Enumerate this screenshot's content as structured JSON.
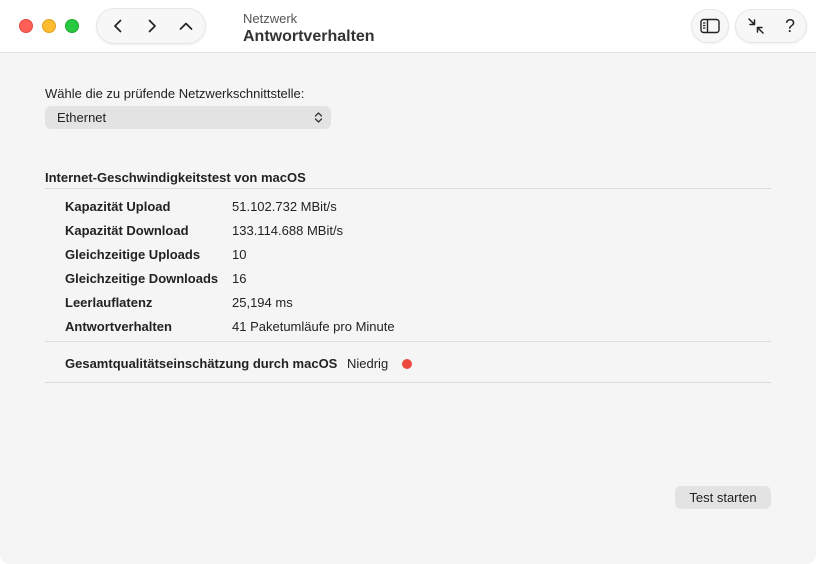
{
  "titlebar": {
    "subtitle": "Netzwerk",
    "title": "Antwortverhalten",
    "help_label": "?"
  },
  "interface": {
    "prompt": "Wähle die zu prüfende Netzwerkschnittstelle:",
    "selected": "Ethernet"
  },
  "speedtest": {
    "section_title": "Internet-Geschwindigkeitstest von macOS",
    "rows": [
      {
        "label": "Kapazität Upload",
        "value": "51.102.732 MBit/s"
      },
      {
        "label": "Kapazität Download",
        "value": "133.114.688 MBit/s"
      },
      {
        "label": "Gleichzeitige Uploads",
        "value": "10"
      },
      {
        "label": "Gleichzeitige Downloads",
        "value": "16"
      },
      {
        "label": "Leerlauflatenz",
        "value": "25,194 ms"
      },
      {
        "label": "Antwortverhalten",
        "value": "41 Paketumläufe pro Minute"
      }
    ],
    "overall_label": "Gesamtqualitätseinschätzung durch macOS",
    "overall_value": "Niedrig",
    "overall_color": "#ec4a3e"
  },
  "actions": {
    "start_test": "Test starten"
  },
  "icons": [
    "close-icon",
    "minimize-icon",
    "zoom-icon",
    "chevron-left-icon",
    "chevron-right-icon",
    "chevron-up-icon",
    "sidebar-icon",
    "collapse-arrows-icon",
    "updown-chevron-icon"
  ]
}
